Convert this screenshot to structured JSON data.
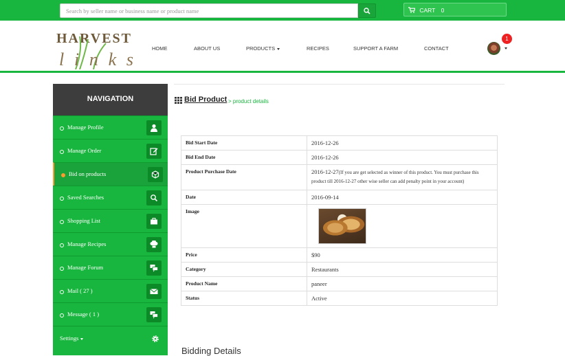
{
  "topbar": {
    "search_placeholder": "Search by seller name or business name or product name",
    "cart_label": "CART",
    "cart_count": "0"
  },
  "brand": {
    "logo_alt": "Harvest Links",
    "logo_text_top": "HARVEST",
    "logo_text_bottom": "links"
  },
  "nav": {
    "home": "HOME",
    "about": "ABOUT US",
    "products": "PRODUCTS",
    "recipes": "RECIPES",
    "support": "SUPPORT A FARM",
    "contact": "CONTACT",
    "notification_count": "1"
  },
  "sidebar": {
    "title": "NAVIGATION",
    "items": [
      {
        "label": "Manage Profile",
        "icon": "user-icon"
      },
      {
        "label": "Manage Order",
        "icon": "edit-icon"
      },
      {
        "label": "Bid on products",
        "icon": "cube-icon",
        "active": true
      },
      {
        "label": "Saved Searches",
        "icon": "search-icon"
      },
      {
        "label": "Shopping List",
        "icon": "briefcase-icon"
      },
      {
        "label": "Manage Recipes",
        "icon": "chef-hat-icon"
      },
      {
        "label": "Manage Forum",
        "icon": "chat-icon"
      },
      {
        "label": "Mail ( 27 )",
        "icon": "mail-icon"
      },
      {
        "label": "Message ( 1 )",
        "icon": "chat-icon"
      }
    ],
    "settings_label": "Settings"
  },
  "page": {
    "title": "Bid Product",
    "subtitle": "> product details"
  },
  "details": {
    "bid_start_label": "Bid Start Date",
    "bid_start_value": "2016-12-26",
    "bid_end_label": "Bid End Date",
    "bid_end_value": "2016-12-26",
    "purchase_label": "Product Purchase Date",
    "purchase_value": "2016-12-27",
    "purchase_note": "(If you are get selected as winner of this product. You must purchase this product till 2016-12-27 other wise seller can add penalty point in your account)",
    "date_label": "Date",
    "date_value": "2016-09-14",
    "image_label": "Image",
    "price_label": "Price",
    "price_value": "$90",
    "category_label": "Category",
    "category_value": "Restaurants",
    "name_label": "Product Name",
    "name_value": "paneer",
    "status_label": "Status",
    "status_value": "Active"
  },
  "bidding_heading": "Bidding Details",
  "colors": {
    "brand_green": "#18b63e",
    "dark_header": "#3d3d3d",
    "active_dot": "#ff9a30",
    "badge_red": "#e22222"
  }
}
